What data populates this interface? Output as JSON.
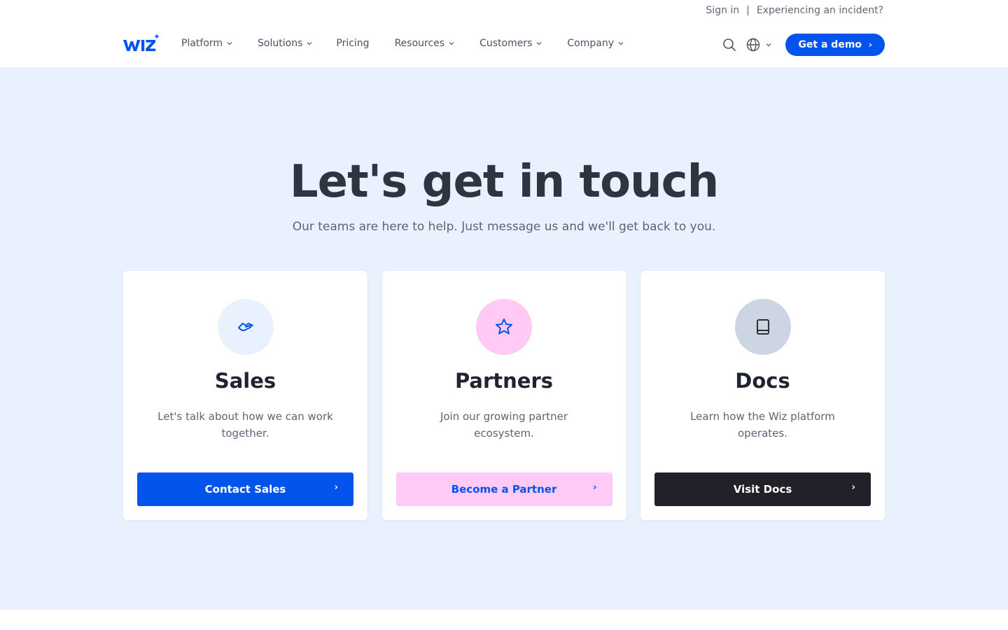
{
  "utility": {
    "sign_in": "Sign in",
    "separator": "|",
    "incident": "Experiencing an incident?"
  },
  "logo": {
    "text": "WIZ"
  },
  "nav": {
    "items": [
      {
        "label": "Platform",
        "has_dropdown": true
      },
      {
        "label": "Solutions",
        "has_dropdown": true
      },
      {
        "label": "Pricing",
        "has_dropdown": false
      },
      {
        "label": "Resources",
        "has_dropdown": true
      },
      {
        "label": "Customers",
        "has_dropdown": true
      },
      {
        "label": "Company",
        "has_dropdown": true
      }
    ],
    "demo_label": "Get a demo",
    "demo_arrow": "›",
    "icons": [
      "search-icon",
      "globe-icon"
    ]
  },
  "hero": {
    "title": "Let's get in touch",
    "subtitle": "Our teams are here to help. Just message us and we'll get back to you."
  },
  "cards": [
    {
      "title": "Sales",
      "description": "Let's talk about how we can work together.",
      "button": "Contact Sales",
      "arrow": "›",
      "icon": "handshake-icon",
      "icon_bg": "#e9f0fe",
      "button_bg": "#0254ec",
      "button_color": "#ffffff"
    },
    {
      "title": "Partners",
      "description": "Join our growing partner ecosystem.",
      "button": "Become a Partner",
      "arrow": "›",
      "icon": "star-icon",
      "icon_bg": "#ffcaf6",
      "button_bg": "#ffcaf6",
      "button_color": "#0254ec"
    },
    {
      "title": "Docs",
      "description": "Learn how the Wiz platform operates.",
      "button": "Visit Docs",
      "arrow": "›",
      "icon": "book-icon",
      "icon_bg": "#ccd5e1",
      "button_bg": "#222029",
      "button_color": "#ffffff"
    }
  ],
  "colors": {
    "brand_blue": "#0254ec",
    "hero_bg": "#e9f0fe",
    "heading": "#2e3440"
  }
}
